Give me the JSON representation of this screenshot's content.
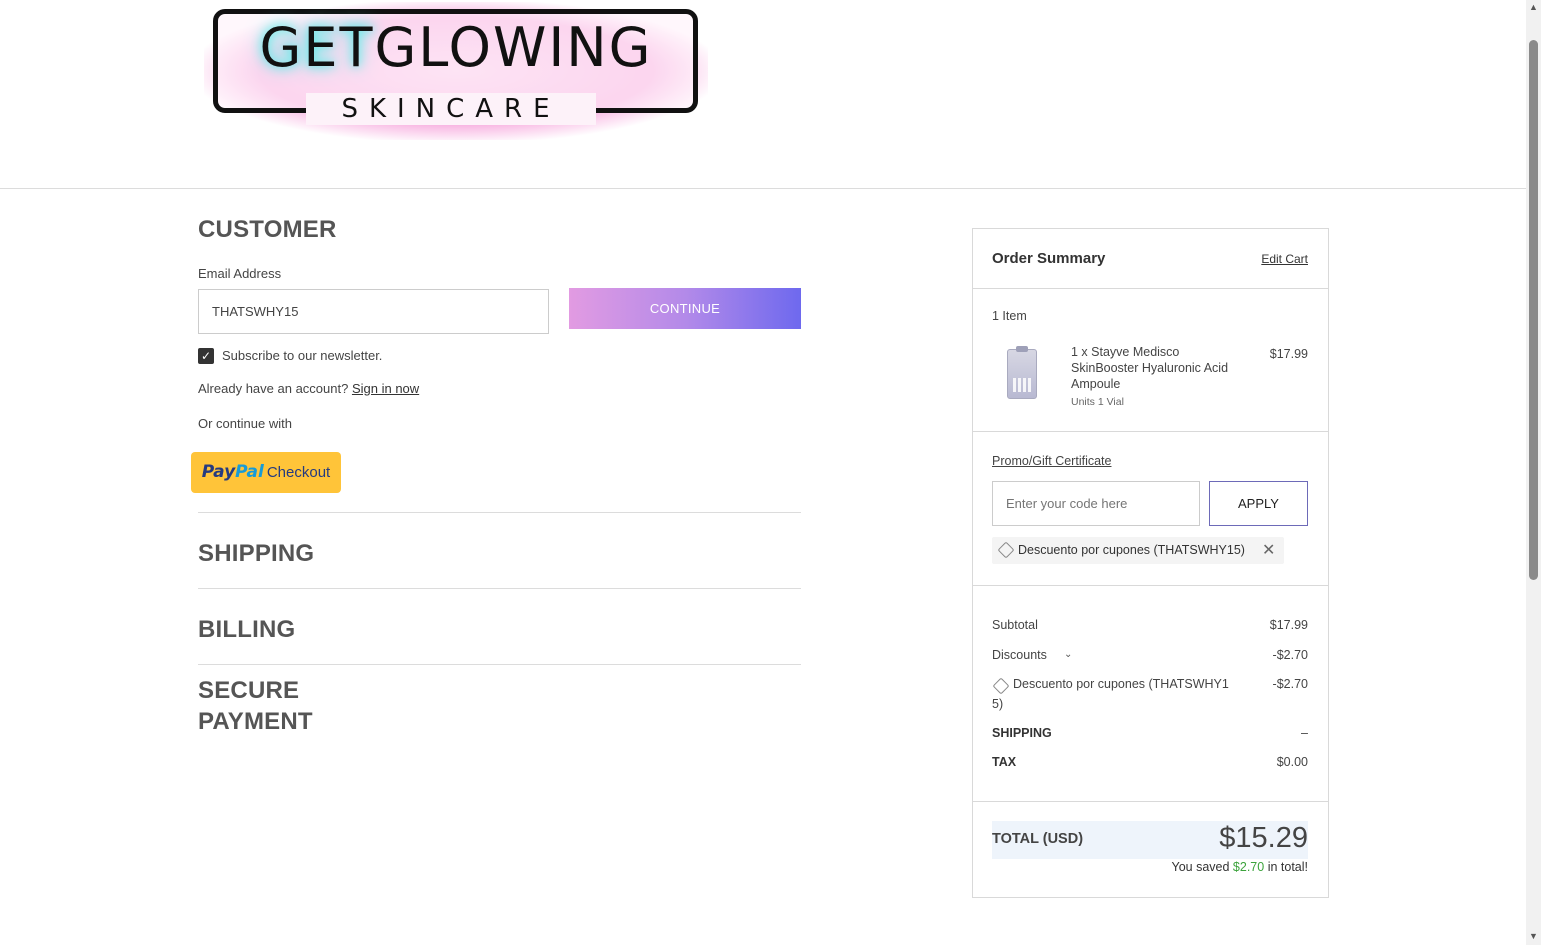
{
  "logo": {
    "main_a": "GET",
    "main_b": "GLOWING",
    "sub": "SKINCARE"
  },
  "customer": {
    "title": "CUSTOMER",
    "email_label": "Email Address",
    "email_value": "THATSWHY15",
    "continue_label": "CONTINUE",
    "newsletter_label": "Subscribe to our newsletter.",
    "newsletter_checked": true,
    "account_prompt": "Already have an account?",
    "sign_in_label": "Sign in now",
    "or_continue": "Or continue with",
    "paypal": {
      "pay": "Pay",
      "pal": "Pal",
      "checkout": "Checkout"
    }
  },
  "sections": {
    "shipping": "SHIPPING",
    "billing": "BILLING",
    "payment_line1": "SECURE",
    "payment_line2": "PAYMENT"
  },
  "summary": {
    "title": "Order Summary",
    "edit_cart": "Edit Cart",
    "item_count": "1 Item",
    "product": {
      "name": "1 x Stayve Medisco SkinBooster Hyaluronic Acid Ampoule",
      "units": "Units 1 Vial",
      "price": "$17.99"
    },
    "promo_label": "Promo/Gift Certificate",
    "promo_placeholder": "Enter your code here",
    "apply_label": "APPLY",
    "applied_coupon": "Descuento por cupones (THATSWHY15)",
    "subtotal_label": "Subtotal",
    "subtotal_value": "$17.99",
    "discounts_label": "Discounts",
    "discounts_value": "-$2.70",
    "discount_line_a": "Descuento por cupones (THATSWHY1",
    "discount_line_b": "5)",
    "discount_line_value": "-$2.70",
    "shipping_label": "SHIPPING",
    "shipping_value": "–",
    "tax_label": "TAX",
    "tax_value": "$0.00",
    "total_label": "TOTAL (USD)",
    "total_value": "$15.29",
    "saved_prefix": "You saved",
    "saved_amount": "$2.70",
    "saved_suffix": "in total!"
  },
  "colors": {
    "continue_gradient_start": "#e29be2",
    "continue_gradient_end": "#6e69ee",
    "paypal_yellow": "#ffc439",
    "saved_green": "#3ca33c",
    "total_band": "#eef4fb"
  },
  "icons": {
    "checkbox": "check-icon",
    "coupon": "tag-icon",
    "remove": "close-icon",
    "discounts_toggle": "chevron-down-icon"
  }
}
